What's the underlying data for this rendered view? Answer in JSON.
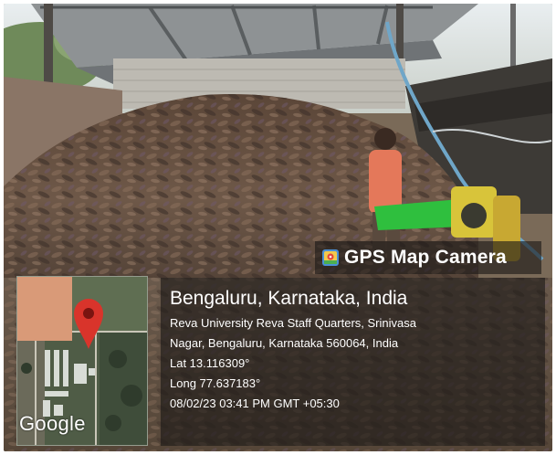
{
  "badge": {
    "title": "GPS Map Camera",
    "icon": "map-camera-icon"
  },
  "location": {
    "city": "Bengaluru, Karnataka, India",
    "address_line1": "Reva University Reva Staff Quarters, Srinivasa",
    "address_line2": "Nagar, Bengaluru, Karnataka 560064, India",
    "latitude": "Lat 13.116309°",
    "longitude": "Long 77.637183°",
    "datetime": "08/02/23 03:41 PM GMT +05:30"
  },
  "map": {
    "attribution": "Google",
    "pin_icon": "map-pin-icon",
    "pin_color": "#d9342b"
  },
  "colors": {
    "overlay": "#1c1816",
    "text": "#ffffff"
  }
}
